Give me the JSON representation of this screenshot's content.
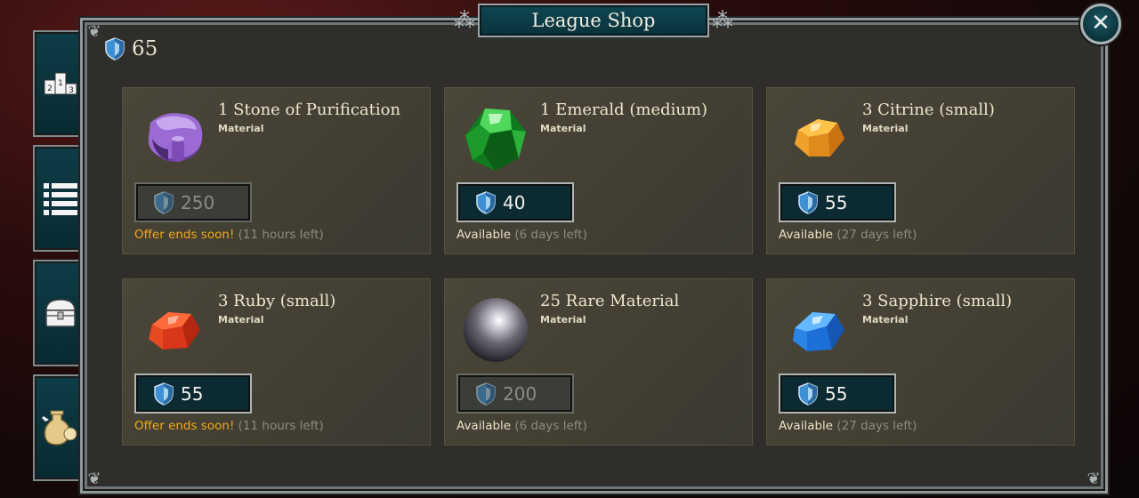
{
  "title": "League Shop",
  "close_label": "✕",
  "currency": {
    "amount": "65",
    "icon": "league-shield-icon"
  },
  "colors": {
    "offer_urgent": "#f0a91c",
    "available": "#e8dfc2",
    "time_left": "#8f8b7d",
    "button_bg": "#0b2a31"
  },
  "side_tabs": [
    {
      "name": "leaderboard-tab",
      "icon": "podium-icon"
    },
    {
      "name": "rankings-list-tab",
      "icon": "list-icon"
    },
    {
      "name": "rewards-chest-tab",
      "icon": "chest-icon"
    },
    {
      "name": "shop-tab",
      "icon": "potion-icon"
    }
  ],
  "items": [
    {
      "name": "1 Stone of Purification",
      "type": "Material",
      "price": "250",
      "disabled": true,
      "status": "Offer ends soon!",
      "status_kind": "urgent",
      "time": "(11 hours left)",
      "icon": "stone-of-purification-icon"
    },
    {
      "name": "1 Emerald (medium)",
      "type": "Material",
      "price": "40",
      "disabled": false,
      "status": "Available",
      "status_kind": "available",
      "time": "(6 days left)",
      "icon": "emerald-icon"
    },
    {
      "name": "3 Citrine (small)",
      "type": "Material",
      "price": "55",
      "disabled": false,
      "status": "Available",
      "status_kind": "available",
      "time": "(27 days left)",
      "icon": "citrine-icon"
    },
    {
      "name": "3 Ruby (small)",
      "type": "Material",
      "price": "55",
      "disabled": false,
      "status": "Offer ends soon!",
      "status_kind": "urgent",
      "time": "(11 hours left)",
      "icon": "ruby-icon"
    },
    {
      "name": "25 Rare Material",
      "type": "Material",
      "price": "200",
      "disabled": true,
      "status": "Available",
      "status_kind": "available",
      "time": "(6 days left)",
      "icon": "rare-material-orb-icon"
    },
    {
      "name": "3 Sapphire (small)",
      "type": "Material",
      "price": "55",
      "disabled": false,
      "status": "Available",
      "status_kind": "available",
      "time": "(27 days left)",
      "icon": "sapphire-icon"
    }
  ]
}
